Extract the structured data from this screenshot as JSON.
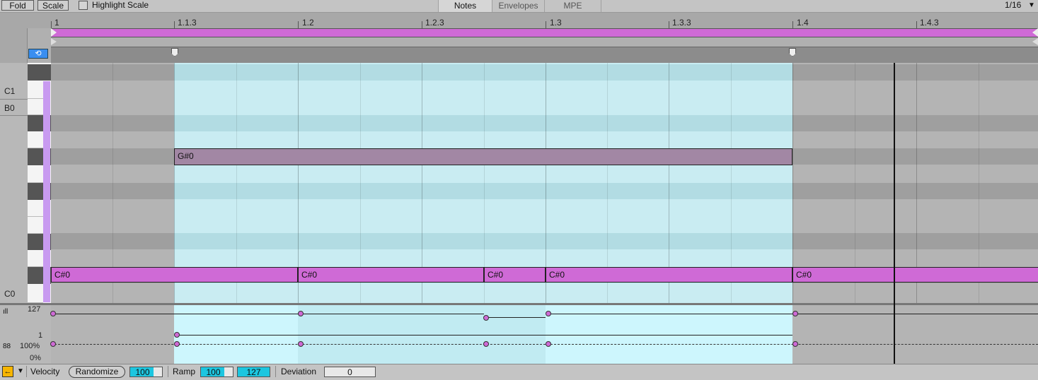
{
  "toolbar": {
    "fold_label": "Fold",
    "scale_label": "Scale",
    "highlight_scale_label": "Highlight Scale",
    "tabs": [
      "Notes",
      "Envelopes",
      "MPE"
    ],
    "grid_value": "1/16"
  },
  "ruler": {
    "labels": [
      "1",
      "1.1.3",
      "1.2",
      "1.2.3",
      "1.3",
      "1.3.3",
      "1.4",
      "1.4.3"
    ]
  },
  "piano": {
    "labels": [
      "C1",
      "B0",
      "C0"
    ]
  },
  "notes": [
    {
      "label": "G#0"
    },
    {
      "label": "C#0"
    },
    {
      "label": "C#0"
    },
    {
      "label": "C#0"
    },
    {
      "label": "C#0"
    },
    {
      "label": "C#0"
    }
  ],
  "velocity_lane": {
    "max_label": "127",
    "min_label": "1",
    "chance_max_label": "100%",
    "chance_min_label": "0%"
  },
  "bottom_bar": {
    "velocity_label": "Velocity",
    "randomize_label": "Randomize",
    "randomize_value": "100",
    "ramp_label": "Ramp",
    "ramp_start": "100",
    "ramp_end": "127",
    "deviation_label": "Deviation",
    "deviation_value": "0"
  },
  "colors": {
    "accent": "#cf6ad6",
    "loop_region": "#cdf6fd",
    "note_selected": "#a287a4",
    "field_cyan": "#1cc6e0",
    "orange": "#f7b500"
  }
}
